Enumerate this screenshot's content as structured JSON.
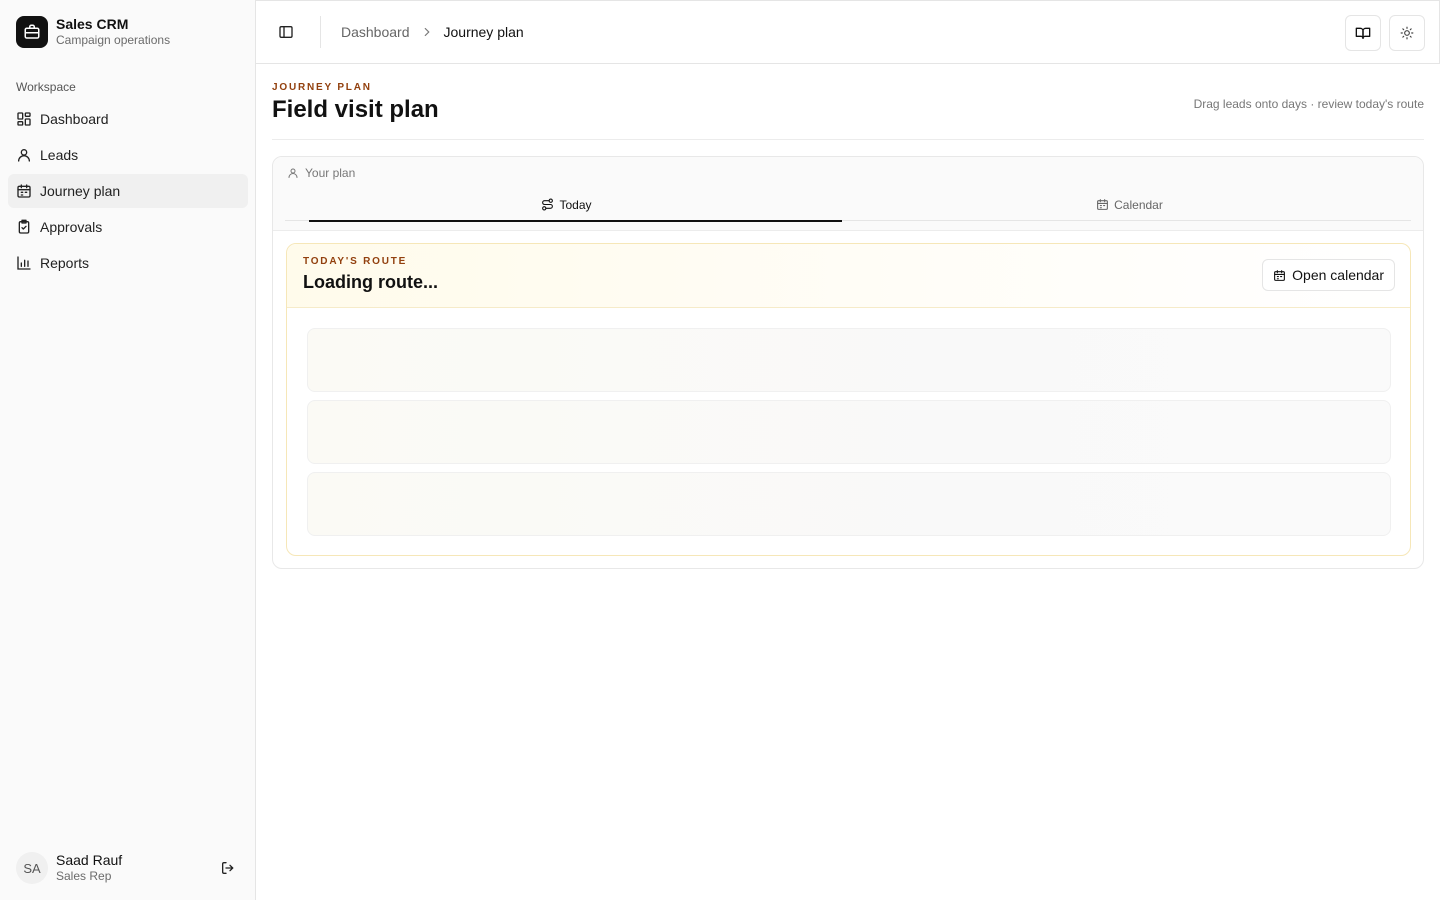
{
  "brand": {
    "title": "Sales CRM",
    "subtitle": "Campaign operations",
    "logo_icon": "briefcase-icon"
  },
  "sidebar": {
    "group_label": "Workspace",
    "items": [
      {
        "label": "Dashboard",
        "icon": "dashboard-icon",
        "active": false
      },
      {
        "label": "Leads",
        "icon": "user-icon",
        "active": false
      },
      {
        "label": "Journey plan",
        "icon": "calendar-icon",
        "active": true
      },
      {
        "label": "Approvals",
        "icon": "clipboard-check-icon",
        "active": false
      },
      {
        "label": "Reports",
        "icon": "bar-chart-icon",
        "active": false
      }
    ]
  },
  "user": {
    "initials": "SA",
    "name": "Saad Rauf",
    "role": "Sales Rep"
  },
  "header": {
    "breadcrumb": [
      "Dashboard",
      "Journey plan"
    ]
  },
  "page": {
    "eyebrow": "JOURNEY PLAN",
    "title": "Field visit plan",
    "hint": "Drag leads onto days · review today's route"
  },
  "plan": {
    "label": "Your plan",
    "tabs": [
      {
        "label": "Today",
        "active": true
      },
      {
        "label": "Calendar",
        "active": false
      }
    ]
  },
  "route": {
    "eyebrow": "TODAY'S ROUTE",
    "title": "Loading route...",
    "open_calendar_label": "Open calendar"
  },
  "colors": {
    "accent": "#92400e",
    "route_border": "#f6e7b8",
    "route_bg": "#fffbeb"
  }
}
